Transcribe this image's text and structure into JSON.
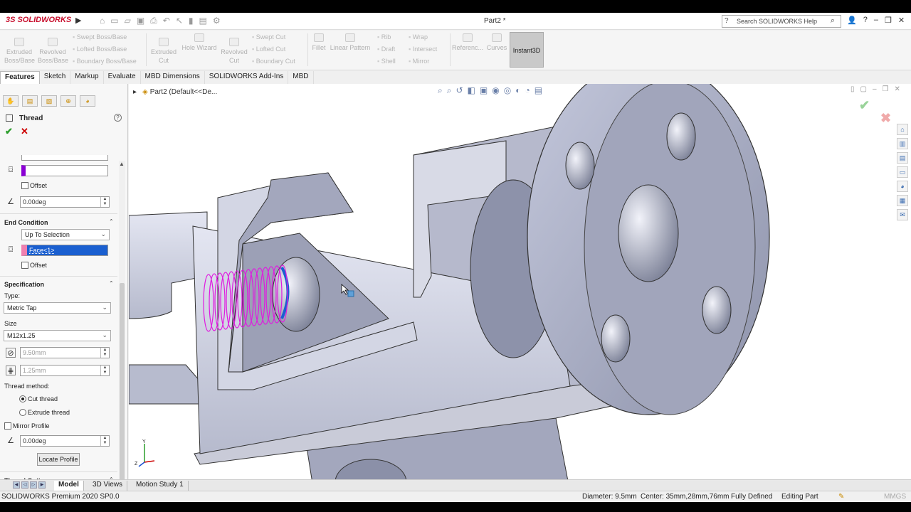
{
  "app": {
    "brand": "SOLIDWORKS",
    "document_title": "Part2 *",
    "search_placeholder": "Search SOLIDWORKS Help"
  },
  "ribbon": {
    "extruded_boss": [
      "Extruded",
      "Boss/Base"
    ],
    "revolved_boss": [
      "Revolved",
      "Boss/Base"
    ],
    "swept_boss": "Swept Boss/Base",
    "lofted_boss": "Lofted Boss/Base",
    "boundary_boss": "Boundary Boss/Base",
    "extruded_cut": [
      "Extruded",
      "Cut"
    ],
    "hole_wizard": "Hole Wizard",
    "revolved_cut": [
      "Revolved",
      "Cut"
    ],
    "swept_cut": "Swept Cut",
    "lofted_cut": "Lofted Cut",
    "boundary_cut": "Boundary Cut",
    "fillet": "Fillet",
    "linear_pattern": "Linear Pattern",
    "rib": "Rib",
    "draft": "Draft",
    "shell": "Shell",
    "wrap": "Wrap",
    "intersect": "Intersect",
    "mirror": "Mirror",
    "reference": "Referenc...",
    "curves": "Curves",
    "instant3d": "Instant3D"
  },
  "tabs": [
    "Features",
    "Sketch",
    "Markup",
    "Evaluate",
    "MBD Dimensions",
    "SOLIDWORKS Add-Ins",
    "MBD"
  ],
  "panel": {
    "title": "Thread",
    "offset_label": "Offset",
    "angle_value": "0.00deg",
    "end_condition": {
      "title": "End Condition",
      "type": "Up To Selection",
      "face_value": "Face<1>",
      "offset_label": "Offset"
    },
    "specification": {
      "title": "Specification",
      "type_label": "Type:",
      "type_value": "Metric Tap",
      "size_label": "Size",
      "size_value": "M12x1.25",
      "diameter": "9.50mm",
      "pitch": "1.25mm",
      "method_label": "Thread method:",
      "cut_thread": "Cut thread",
      "extrude_thread": "Extrude thread",
      "mirror_profile": "Mirror Profile",
      "angle_value": "0.00deg",
      "locate_profile": "Locate Profile"
    },
    "thread_options": "Thread Options"
  },
  "viewport": {
    "tree_item": "Part2  (Default<<De..."
  },
  "bottom_tabs": [
    "Model",
    "3D Views",
    "Motion Study 1"
  ],
  "status": {
    "version": "SOLIDWORKS Premium 2020 SP0.0",
    "diameter": "Diameter: 9.5mm",
    "center": "Center: 35mm,28mm,76mm",
    "defined": "Fully Defined",
    "mode": "Editing Part",
    "units": "MMGS"
  },
  "colors": {
    "thread_helix": "#e01ae0",
    "part_face": "#9aa0b8",
    "accent_select": "#1a5fd0"
  }
}
